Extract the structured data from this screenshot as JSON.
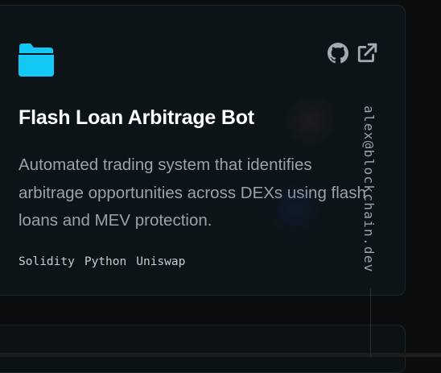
{
  "project": {
    "title": "Flash Loan Arbitrage Bot",
    "description": "Automated trading system that identifies arbitrage opportunities across DEXs using flash loans and MEV protection.",
    "tags": [
      "Solidity",
      "Python",
      "Uniswap"
    ],
    "icons": {
      "folder": "folder-icon",
      "github": "github-icon",
      "external": "external-link-icon"
    }
  },
  "contact": {
    "email": "alex@blockchain.dev"
  },
  "colors": {
    "accent": "#14c8f5",
    "title": "#ffffff",
    "text": "#9aa3ab",
    "card_bg": "#0c1418",
    "page_bg": "#0c0d0e"
  }
}
